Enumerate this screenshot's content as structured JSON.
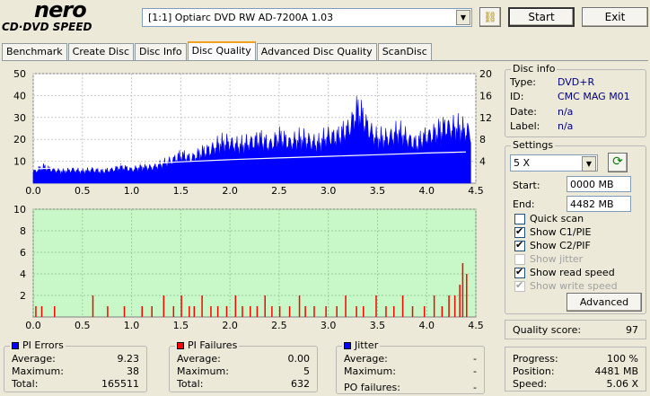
{
  "header": {
    "logo_text": "nero",
    "logo_sub": "CD·DVD SPEED",
    "drive": "[1:1]  Optiarc DVD RW AD-7200A 1.03",
    "start_label": "Start",
    "exit_label": "Exit"
  },
  "tabs": [
    {
      "label": "Benchmark"
    },
    {
      "label": "Create Disc"
    },
    {
      "label": "Disc Info"
    },
    {
      "label": "Disc Quality",
      "active": true
    },
    {
      "label": "Advanced Disc Quality"
    },
    {
      "label": "ScanDisc"
    }
  ],
  "disc_info": {
    "title": "Disc info",
    "type_label": "Type:",
    "type_value": "DVD+R",
    "id_label": "ID:",
    "id_value": "CMC MAG M01",
    "date_label": "Date:",
    "date_value": "n/a",
    "label_label": "Label:",
    "label_value": "n/a"
  },
  "settings": {
    "title": "Settings",
    "speed": "5 X",
    "start_label": "Start:",
    "start_value": "0000 MB",
    "end_label": "End:",
    "end_value": "4482 MB",
    "checks": [
      {
        "label": "Quick scan",
        "checked": false,
        "disabled": false
      },
      {
        "label": "Show C1/PIE",
        "checked": true,
        "disabled": false
      },
      {
        "label": "Show C2/PIF",
        "checked": true,
        "disabled": false
      },
      {
        "label": "Show jitter",
        "checked": false,
        "disabled": true
      },
      {
        "label": "Show read speed",
        "checked": true,
        "disabled": false
      },
      {
        "label": "Show write speed",
        "checked": true,
        "disabled": true
      }
    ],
    "advanced_label": "Advanced"
  },
  "quality": {
    "label": "Quality score:",
    "value": "97"
  },
  "progress": {
    "progress_label": "Progress:",
    "progress_value": "100 %",
    "position_label": "Position:",
    "position_value": "4481 MB",
    "speed_label": "Speed:",
    "speed_value": "5.06 X"
  },
  "pi_errors": {
    "title": "PI Errors",
    "average_label": "Average:",
    "average_value": "9.23",
    "maximum_label": "Maximum:",
    "maximum_value": "38",
    "total_label": "Total:",
    "total_value": "165511"
  },
  "pi_failures": {
    "title": "PI Failures",
    "average_label": "Average:",
    "average_value": "0.00",
    "maximum_label": "Maximum:",
    "maximum_value": "5",
    "total_label": "Total:",
    "total_value": "632"
  },
  "jitter": {
    "title": "Jitter",
    "average_label": "Average:",
    "average_value": "-",
    "maximum_label": "Maximum:",
    "maximum_value": "-",
    "po_label": "PO failures:",
    "po_value": "-"
  },
  "colors": {
    "pie_fill": "#0000ff",
    "pif_fill": "#ff0000",
    "pif_bg": "#c8f8c8",
    "read_speed_line": "#ffffff",
    "accent_tab": "#f1a020"
  },
  "chart_data": [
    {
      "type": "area",
      "name": "pi-errors-chart",
      "x_ticks": [
        "0.0",
        "0.5",
        "1.0",
        "1.5",
        "2.0",
        "2.5",
        "3.0",
        "3.5",
        "4.0",
        "4.5"
      ],
      "y_left_ticks": [
        "10",
        "20",
        "30",
        "40",
        "50"
      ],
      "y_right_ticks": [
        "4",
        "8",
        "12",
        "16",
        "20"
      ],
      "xlim": [
        0,
        4.5
      ],
      "ylim_left": [
        0,
        50
      ],
      "ylim_right": [
        0,
        20
      ],
      "series": [
        {
          "x": [
            0.0,
            0.1,
            0.2,
            0.3,
            0.4,
            0.5,
            0.6,
            0.7,
            0.8,
            0.9,
            1.0,
            1.1,
            1.2,
            1.3,
            1.4,
            1.5,
            1.6,
            1.7,
            1.8,
            1.9,
            2.0,
            2.1,
            2.2,
            2.3,
            2.4,
            2.5,
            2.6,
            2.7,
            2.8,
            2.9,
            3.0,
            3.1,
            3.2,
            3.3,
            3.4,
            3.5,
            3.6,
            3.7,
            3.8,
            3.9,
            4.0,
            4.1,
            4.2,
            4.3,
            4.4
          ],
          "values": [
            5,
            7,
            6,
            5,
            6,
            5,
            6,
            5,
            6,
            7,
            6,
            7,
            7,
            8,
            10,
            12,
            11,
            13,
            15,
            17,
            18,
            16,
            18,
            19,
            17,
            20,
            18,
            19,
            19,
            17,
            21,
            20,
            24,
            32,
            25,
            19,
            20,
            22,
            20,
            17,
            21,
            22,
            25,
            24,
            23
          ]
        },
        {
          "x": [
            0.0,
            0.5,
            1.0,
            1.5,
            2.0,
            2.5,
            3.0,
            3.5,
            4.0,
            4.4
          ],
          "values": [
            2.6,
            3.0,
            3.4,
            3.9,
            4.3,
            4.6,
            4.9,
            5.2,
            5.5,
            5.7
          ]
        }
      ]
    },
    {
      "type": "bar",
      "name": "pi-failures-chart",
      "x_ticks": [
        "0.0",
        "0.5",
        "1.0",
        "1.5",
        "2.0",
        "2.5",
        "3.0",
        "3.5",
        "4.0",
        "4.5"
      ],
      "y_ticks": [
        "2",
        "4",
        "6",
        "8",
        "10"
      ],
      "xlim": [
        0,
        4.5
      ],
      "ylim": [
        0,
        10
      ],
      "x": [
        0.02,
        0.08,
        0.21,
        0.6,
        0.75,
        0.92,
        1.1,
        1.2,
        1.32,
        1.42,
        1.5,
        1.58,
        1.63,
        1.71,
        1.8,
        1.87,
        1.96,
        2.05,
        2.12,
        2.2,
        2.27,
        2.35,
        2.42,
        2.5,
        2.6,
        2.7,
        2.76,
        2.85,
        2.97,
        3.08,
        3.17,
        3.28,
        3.35,
        3.48,
        3.58,
        3.66,
        3.75,
        3.85,
        3.97,
        4.07,
        4.15,
        4.22,
        4.28,
        4.33,
        4.36,
        4.4
      ],
      "values": [
        1,
        1,
        1,
        2,
        1,
        1,
        1,
        1,
        2,
        1,
        2,
        1,
        1,
        2,
        1,
        1,
        1,
        2,
        1,
        1,
        1,
        2,
        1,
        1,
        1,
        2,
        1,
        1,
        1,
        1,
        2,
        1,
        1,
        2,
        1,
        1,
        2,
        1,
        1,
        2,
        1,
        2,
        2,
        3,
        5,
        4
      ]
    }
  ]
}
